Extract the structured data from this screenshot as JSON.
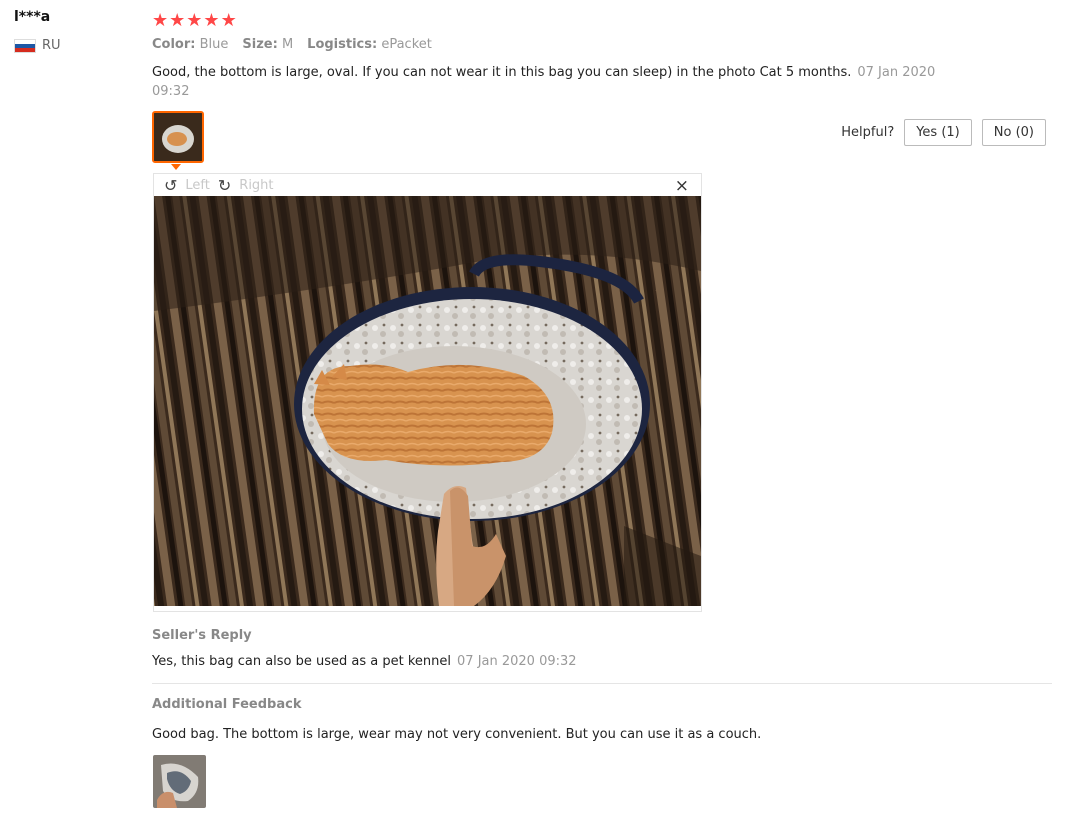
{
  "review": {
    "user": "l***a",
    "country": "RU",
    "rating": 5,
    "star_glyph": "★",
    "attributes": [
      {
        "label": "Color:",
        "value": "Blue"
      },
      {
        "label": "Size:",
        "value": "M"
      },
      {
        "label": "Logistics:",
        "value": "ePacket"
      }
    ],
    "text": "Good, the bottom is large, oval. If you can not wear it in this bag you can sleep) in the photo Cat 5 months.",
    "date": "07 Jan 2020 09:32",
    "helpful_label": "Helpful?",
    "yes_label": "Yes (1)",
    "no_label": "No (0)"
  },
  "viewer": {
    "rotate_left_icon": "↺",
    "rotate_left_label": "Left",
    "rotate_right_icon": "↻",
    "rotate_right_label": "Right",
    "close_icon": "×"
  },
  "seller_reply": {
    "title": "Seller's Reply",
    "text": "Yes, this bag can also be used as a pet kennel",
    "date": "07 Jan 2020 09:32"
  },
  "additional_feedback": {
    "title": "Additional Feedback",
    "text": "Good bag. The bottom is large, wear may not very convenient. But you can use it as a couch."
  },
  "colors": {
    "star": "#ff4747",
    "accent": "#ff6600"
  }
}
